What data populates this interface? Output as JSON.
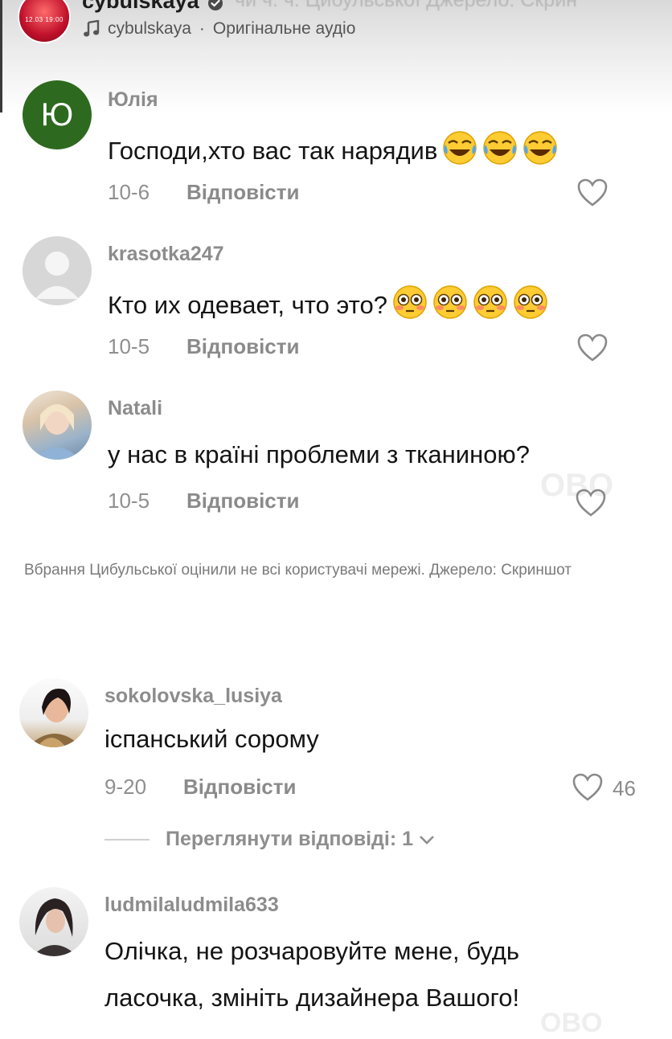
{
  "post": {
    "username": "cybulskaya",
    "header_overlay_text": "чи ч. ч. Цибульської Джерело: Скрин",
    "audio_user": "cybulskaya",
    "audio_separator": "·",
    "audio_label": "Оригінальне аудіо",
    "avatar_text": "12.03 19:00"
  },
  "comments": [
    {
      "avatar_letter": "Ю",
      "username": "Юлія",
      "text": "Господи,хто вас так нарядив",
      "date": "10-6",
      "reply_label": "Відповісти",
      "likes": ""
    },
    {
      "avatar_letter": "",
      "username": "krasotka247",
      "text": "Кто их одевает, что это?",
      "date": "10-5",
      "reply_label": "Відповісти",
      "likes": ""
    },
    {
      "avatar_letter": "",
      "username": "Natali",
      "text": "у нас в країні проблеми з тканиною?",
      "date": "10-5",
      "reply_label": "Відповісти",
      "likes": ""
    },
    {
      "avatar_letter": "",
      "username": "sokolovska_lusiya",
      "text": "іспанський сорому",
      "date": "9-20",
      "reply_label": "Відповісти",
      "likes": "46"
    },
    {
      "avatar_letter": "",
      "username": "ludmilaludmila633",
      "text_line1": "Олічка, не розчаровуйте мене, будь",
      "text_line2": "ласочка, змініть дизайнера Вашого!"
    }
  ],
  "caption": "Вбрання Цибульської оцінили не всі користувачі мережі. Джерело: Скриншот",
  "view_replies": "Переглянути відповіді: 1",
  "watermark": "OBO",
  "icons": {
    "heart": "heart-outline-icon",
    "verified": "verified-badge-icon",
    "music": "music-note-icon",
    "chevron": "chevron-down-icon",
    "tears_of_joy": "face-with-tears-of-joy-emoji",
    "flushed": "flushed-face-emoji"
  }
}
